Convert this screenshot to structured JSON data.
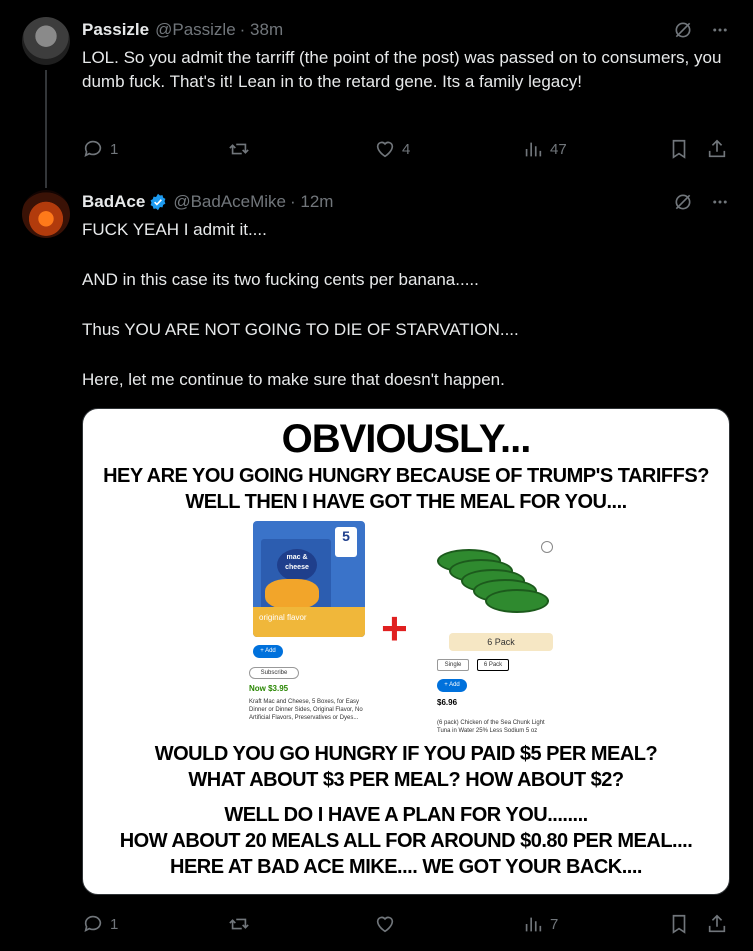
{
  "reply1": {
    "name": "Passizle",
    "handle": "@Passizle",
    "time": "· 38m",
    "text": "LOL. So you admit the tarriff (the point of the post) was passed on to consumers, you dumb fuck. That's it! Lean in to the retard gene. Its a family legacy!",
    "replies": "1",
    "reposts": "",
    "likes": "4",
    "views": "47"
  },
  "reply2": {
    "name": "BadAce",
    "handle": "@BadAceMike",
    "time": "· 12m",
    "lines": [
      "FUCK YEAH I admit it....",
      "AND in this case its two fucking cents per banana.....",
      "Thus YOU ARE NOT GOING TO DIE OF STARVATION....",
      "Here, let me continue to make sure that doesn't happen."
    ],
    "replies": "1",
    "reposts": "",
    "likes": "",
    "views": "7"
  },
  "meme": {
    "title": "OBVIOUSLY...",
    "line1": "HEY ARE YOU GOING HUNGRY BECAUSE OF TRUMP'S TARIFFS?",
    "line2": "WELL THEN I HAVE GOT THE MEAL FOR YOU....",
    "line3": "WOULD YOU GO HUNGRY IF YOU PAID $5 PER MEAL?",
    "line4": "WHAT ABOUT $3 PER MEAL? HOW ABOUT $2?",
    "line5": "WELL DO I HAVE A PLAN FOR YOU........",
    "line6": "HOW ABOUT 20 MEALS ALL FOR AROUND $0.80 PER MEAL....",
    "line7": "HERE AT BAD ACE MIKE.... WE GOT YOUR BACK....",
    "product1": {
      "box_brand": "mac & cheese",
      "box_count": "5",
      "box_flavor": "original flavor",
      "add": "+ Add",
      "subscribe": "Subscribe",
      "price": "Now $3.95",
      "desc": "Kraft Mac and Cheese, 5 Boxes, for Easy Dinner or Dinner Sides, Original Flavor, No Artificial Flavors, Preservatives or Dyes..."
    },
    "product2": {
      "pack": "6 Pack",
      "opt1": "Single",
      "opt2": "6 Pack",
      "add": "+ Add",
      "price": "$6.96",
      "desc": "(6 pack) Chicken of the Sea Chunk Light Tuna in Water 25% Less Sodium 5 oz"
    }
  },
  "colors": {
    "muted": "#71767b",
    "verified": "#1d9bf0",
    "background": "#000000"
  }
}
